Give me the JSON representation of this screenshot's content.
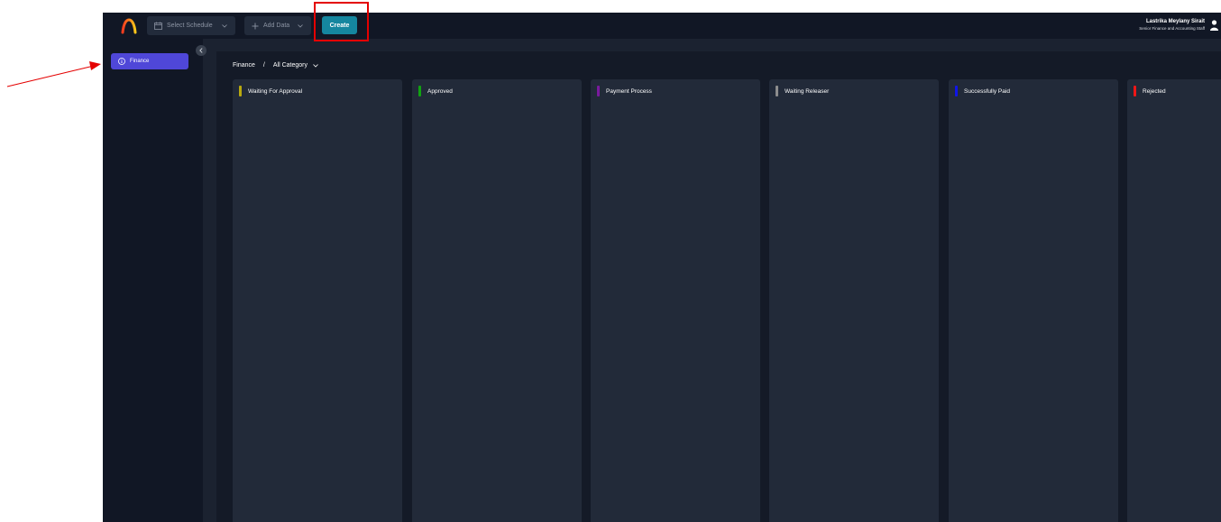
{
  "header": {
    "select_schedule": "Select Schedule",
    "add_data": "Add Data",
    "create": "Create",
    "user_name": "Lastrika Meylany Sirait",
    "user_role": "Senior Finance and Accounting Staff"
  },
  "sidebar": {
    "items": [
      {
        "label": "Finance",
        "icon": "info-circle-icon"
      }
    ]
  },
  "breadcrumb": {
    "root": "Finance",
    "separator": "/",
    "category": "All Category"
  },
  "columns": [
    {
      "title": "Waiting For Approval",
      "color": "#b9a90f"
    },
    {
      "title": "Approved",
      "color": "#11a311"
    },
    {
      "title": "Payment Process",
      "color": "#7a1a9e"
    },
    {
      "title": "Waiting Releaser",
      "color": "#8d8d8d"
    },
    {
      "title": "Successfully Paid",
      "color": "#1015e8"
    },
    {
      "title": "Rejected",
      "color": "#ef1616"
    }
  ],
  "colors": {
    "accent": "#4f47d8",
    "create_button": "#15869f",
    "annotation": "#e40000"
  }
}
